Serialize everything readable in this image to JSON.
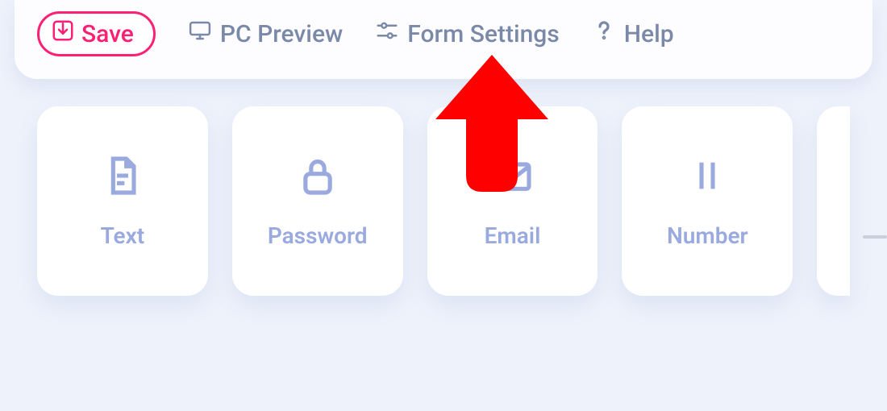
{
  "toolbar": {
    "save_label": "Save",
    "pc_preview_label": "PC Preview",
    "form_settings_label": "Form Settings",
    "help_label": "Help"
  },
  "cards": {
    "text": "Text",
    "password": "Password",
    "email": "Email",
    "number": "Number"
  },
  "colors": {
    "accent": "#ff1f74",
    "muted": "#7b89a8",
    "icon": "#9aaade"
  },
  "annotation": {
    "target": "form-settings-button",
    "kind": "arrow-up",
    "color": "#ff0000"
  }
}
